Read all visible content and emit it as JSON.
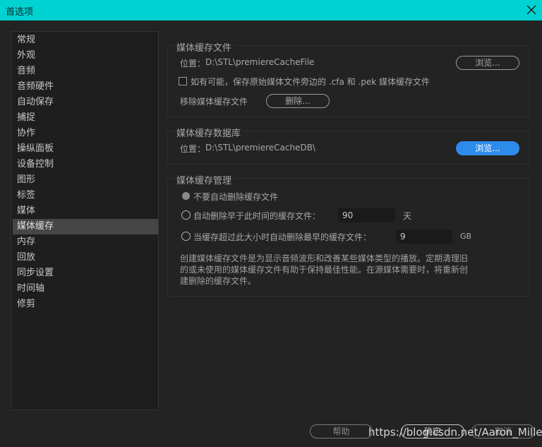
{
  "window": {
    "title": "首选项"
  },
  "sidebar": {
    "items": [
      {
        "label": "常规"
      },
      {
        "label": "外观"
      },
      {
        "label": "音频"
      },
      {
        "label": "音频硬件"
      },
      {
        "label": "自动保存"
      },
      {
        "label": "捕捉"
      },
      {
        "label": "协作"
      },
      {
        "label": "操纵面板"
      },
      {
        "label": "设备控制"
      },
      {
        "label": "图形"
      },
      {
        "label": "标签"
      },
      {
        "label": "媒体"
      },
      {
        "label": "媒体缓存"
      },
      {
        "label": "内存"
      },
      {
        "label": "回放"
      },
      {
        "label": "同步设置"
      },
      {
        "label": "时间轴"
      },
      {
        "label": "修剪"
      }
    ],
    "active_index": 12
  },
  "media_cache_files": {
    "title": "媒体缓存文件",
    "location_label": "位置：",
    "location_path": "D:\\STL\\premiereCacheFile",
    "browse_label": "浏览...",
    "checkbox_label": "如有可能，保存原始媒体文件旁边的 .cfa 和 .pek 媒体缓存文件",
    "checkbox_checked": false,
    "remove_label": "移除媒体缓存文件",
    "delete_label": "删除..."
  },
  "media_cache_db": {
    "title": "媒体缓存数据库",
    "location_label": "位置：",
    "location_path": "D:\\STL\\premiereCacheDB\\",
    "browse_label": "浏览..."
  },
  "media_cache_mgmt": {
    "title": "媒体缓存管理",
    "option1_label": "不要自动删除缓存文件",
    "option2_label": "自动删除早于此时间的缓存文件：",
    "option2_value": "90",
    "option2_unit": "天",
    "option3_label": "当缓存超过此大小时自动删除最早的缓存文件：",
    "option3_value": "9",
    "option3_unit": "GB",
    "selected_option": 1,
    "description": "创建媒体缓存文件是为显示音频波形和改善某些媒体类型的播放。定期清理旧的或未使用的媒体缓存文件有助于保持最佳性能。在源媒体需要时，将重新创建删除的缓存文件。"
  },
  "footer": {
    "help_label": "帮助",
    "ok_label": "确定",
    "cancel_label": "取消"
  },
  "watermark": "https://blog.csdn.net/Aaron_Miller",
  "colors": {
    "titlebar": "#00d2d2",
    "background": "#232323",
    "accent_button": "#2d8ceb",
    "active_item": "#464646"
  }
}
